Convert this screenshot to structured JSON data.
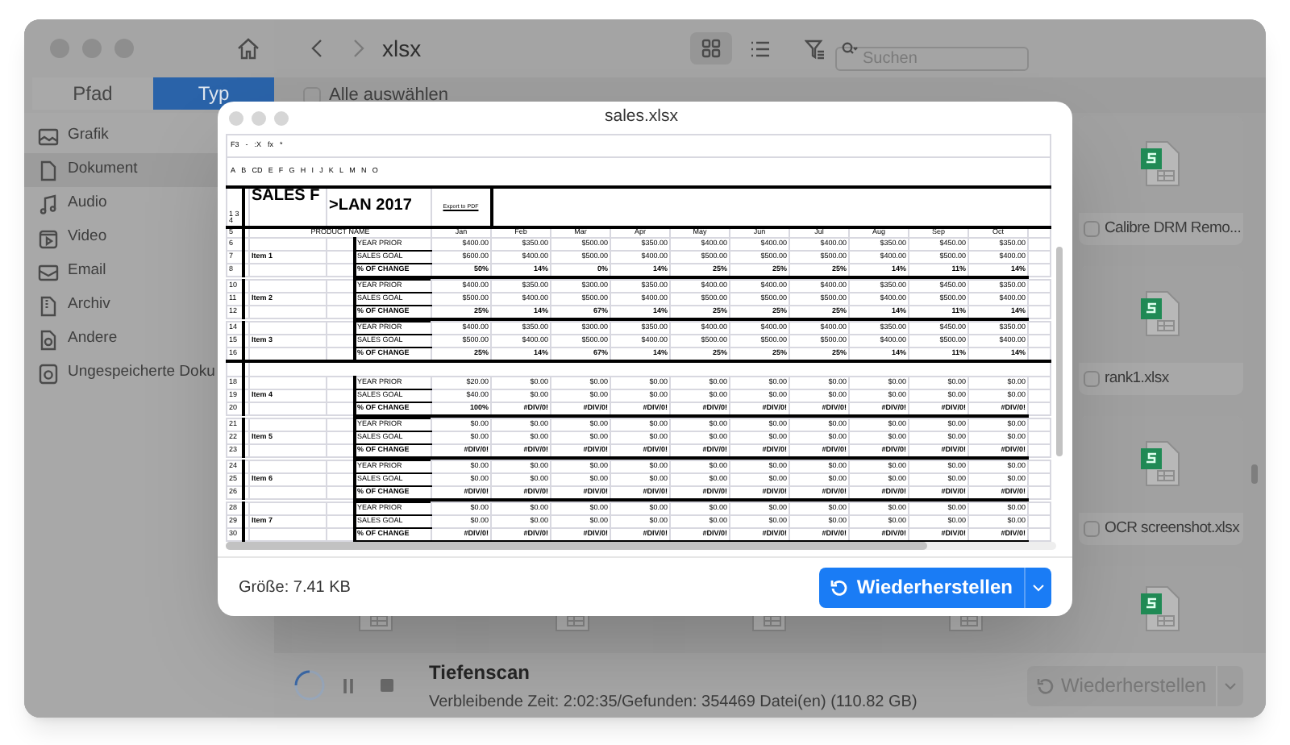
{
  "app": {
    "title": "xlsx",
    "views": [
      {
        "selected": true
      },
      {
        "selected": false
      }
    ],
    "search": {
      "placeholder": "Suchen"
    },
    "tabs": [
      {
        "label": "Pfad",
        "selected": false
      },
      {
        "label": "Typ",
        "selected": true
      }
    ],
    "select_all": {
      "label": "Alle auswählen",
      "checked": false
    },
    "sidebar": {
      "items": [
        {
          "label": "Grafik",
          "selected": false
        },
        {
          "label": "Dokument",
          "selected": true
        },
        {
          "label": "Audio",
          "selected": false
        },
        {
          "label": "Video",
          "selected": false
        },
        {
          "label": "Email",
          "selected": false
        },
        {
          "label": "Archiv",
          "selected": false
        },
        {
          "label": "Andere",
          "selected": false
        },
        {
          "label": "Ungespeicherte Doku",
          "selected": false
        }
      ]
    },
    "files": [
      {
        "name": "Calibre DRM Remo...",
        "checked": false
      },
      {
        "name": "rank1.xlsx",
        "checked": false
      },
      {
        "name": "OCR screenshot.xlsx",
        "checked": false
      }
    ],
    "scan": {
      "title": "Tiefenscan",
      "status": "Verbleibende Zeit: 2:02:35/Gefunden: 354469 Datei(en) (110.82 GB)",
      "button": "Wiederherstellen",
      "disabled": true
    }
  },
  "preview": {
    "title": "sales.xlsx",
    "size": "Größe: 7.41 KB",
    "button": "Wiederherstellen",
    "sheet": {
      "formula_bar": [
        "F3",
        "-",
        ":X",
        "fx",
        "*"
      ],
      "column_letters": [
        "A",
        "B",
        "CD",
        "E",
        "F",
        "G",
        "H",
        "I",
        "J",
        "K",
        "L",
        "M",
        "N",
        "O"
      ],
      "header_row_numbers": "1 3 4",
      "title_left": "SALES F",
      "title_right": ">LAN 2017",
      "export": "Export to PDF",
      "months_row_number": "5",
      "product_header": "PRODUCT NAME",
      "months": [
        "Jan",
        "Feb",
        "Mar",
        "Apr",
        "May",
        "Jun",
        "Jul",
        "Aug",
        "Sep",
        "Oct"
      ],
      "groups": [
        {
          "item": "Item 1",
          "rows": [
            {
              "number": "6",
              "label": "YEAR PRIOR",
              "values": [
                "$400.00",
                "$350.00",
                "$500.00",
                "$350.00",
                "$400.00",
                "$400.00",
                "$400.00",
                "$350.00",
                "$450.00",
                "$350.00"
              ]
            },
            {
              "number": "7",
              "label": "SALES GOAL",
              "values": [
                "$600.00",
                "$400.00",
                "$500.00",
                "$400.00",
                "$500.00",
                "$500.00",
                "$500.00",
                "$400.00",
                "$500.00",
                "$400.00"
              ]
            },
            {
              "number": "8",
              "label": "% OF CHANGE",
              "values": [
                "50%",
                "14%",
                "0%",
                "14%",
                "25%",
                "25%",
                "25%",
                "14%",
                "11%",
                "14%"
              ]
            }
          ]
        },
        {
          "item": "Item 2",
          "rows": [
            {
              "number": "10",
              "label": "YEAR PRIOR",
              "values": [
                "$400.00",
                "$350.00",
                "$300.00",
                "$350.00",
                "$400.00",
                "$400.00",
                "$400.00",
                "$350.00",
                "$450.00",
                "$350.00"
              ]
            },
            {
              "number": "11",
              "label": "SALES GOAL",
              "values": [
                "$500.00",
                "$400.00",
                "$500.00",
                "$400.00",
                "$500.00",
                "$500.00",
                "$500.00",
                "$400.00",
                "$500.00",
                "$400.00"
              ]
            },
            {
              "number": "12",
              "label": "% OF CHANGE",
              "values": [
                "25%",
                "14%",
                "67%",
                "14%",
                "25%",
                "25%",
                "25%",
                "14%",
                "11%",
                "14%"
              ]
            }
          ]
        },
        {
          "item": "Item 3",
          "rows": [
            {
              "number": "14",
              "label": "YEAR PRIOR",
              "values": [
                "$400.00",
                "$350.00",
                "$300.00",
                "$350.00",
                "$400.00",
                "$400.00",
                "$400.00",
                "$350.00",
                "$450.00",
                "$350.00"
              ]
            },
            {
              "number": "15",
              "label": "SALES GOAL",
              "values": [
                "$500.00",
                "$400.00",
                "$500.00",
                "$400.00",
                "$500.00",
                "$500.00",
                "$500.00",
                "$400.00",
                "$500.00",
                "$400.00"
              ]
            },
            {
              "number": "16",
              "label": "% OF CHANGE",
              "values": [
                "25%",
                "14%",
                "67%",
                "14%",
                "25%",
                "25%",
                "25%",
                "14%",
                "11%",
                "14%"
              ]
            }
          ]
        },
        {
          "item": "Item 4",
          "rows": [
            {
              "number": "18",
              "label": "YEAR PRIOR",
              "values": [
                "$20.00",
                "$0.00",
                "$0.00",
                "$0.00",
                "$0.00",
                "$0.00",
                "$0.00",
                "$0.00",
                "$0.00",
                "$0.00"
              ]
            },
            {
              "number": "19",
              "label": "SALES GOAL",
              "values": [
                "$40.00",
                "$0.00",
                "$0.00",
                "$0.00",
                "$0.00",
                "$0.00",
                "$0.00",
                "$0.00",
                "$0.00",
                "$0.00"
              ]
            },
            {
              "number": "20",
              "label": "% OF CHANGE",
              "values": [
                "100%",
                "#DIV/0!",
                "#DIV/0!",
                "#DIV/0!",
                "#DIV/0!",
                "#DIV/0!",
                "#DIV/0!",
                "#DIV/0!",
                "#DIV/0!",
                "#DIV/0!"
              ]
            }
          ]
        },
        {
          "item": "Item 5",
          "rows": [
            {
              "number": "21",
              "label": "YEAR PRIOR",
              "values": [
                "$0.00",
                "$0.00",
                "$0.00",
                "$0.00",
                "$0.00",
                "$0.00",
                "$0.00",
                "$0.00",
                "$0.00",
                "$0.00"
              ]
            },
            {
              "number": "22",
              "label": "SALES GOAL",
              "values": [
                "$0.00",
                "$0.00",
                "$0.00",
                "$0.00",
                "$0.00",
                "$0.00",
                "$0.00",
                "$0.00",
                "$0.00",
                "$0.00"
              ]
            },
            {
              "number": "23",
              "label": "% OF CHANGE",
              "values": [
                "#DIV/0!",
                "#DIV/0!",
                "#DIV/0!",
                "#DIV/0!",
                "#DIV/0!",
                "#DIV/0!",
                "#DIV/0!",
                "#DIV/0!",
                "#DIV/0!",
                "#DIV/0!"
              ]
            }
          ]
        },
        {
          "item": "Item 6",
          "rows": [
            {
              "number": "24",
              "label": "YEAR PRIOR",
              "values": [
                "$0.00",
                "$0.00",
                "$0.00",
                "$0.00",
                "$0.00",
                "$0.00",
                "$0.00",
                "$0.00",
                "$0.00",
                "$0.00"
              ]
            },
            {
              "number": "25",
              "label": "SALES GOAL",
              "values": [
                "$0.00",
                "$0.00",
                "$0.00",
                "$0.00",
                "$0.00",
                "$0.00",
                "$0.00",
                "$0.00",
                "$0.00",
                "$0.00"
              ]
            },
            {
              "number": "26",
              "label": "% OF CHANGE",
              "values": [
                "#DIV/0!",
                "#DIV/0!",
                "#DIV/0!",
                "#DIV/0!",
                "#DIV/0!",
                "#DIV/0!",
                "#DIV/0!",
                "#DIV/0!",
                "#DIV/0!",
                "#DIV/0!"
              ]
            }
          ]
        },
        {
          "item": "Item 7",
          "rows": [
            {
              "number": "28",
              "label": "YEAR PRIOR",
              "values": [
                "$0.00",
                "$0.00",
                "$0.00",
                "$0.00",
                "$0.00",
                "$0.00",
                "$0.00",
                "$0.00",
                "$0.00",
                "$0.00"
              ]
            },
            {
              "number": "29",
              "label": "SALES GOAL",
              "values": [
                "$0.00",
                "$0.00",
                "$0.00",
                "$0.00",
                "$0.00",
                "$0.00",
                "$0.00",
                "$0.00",
                "$0.00",
                "$0.00"
              ]
            },
            {
              "number": "30",
              "label": "% OF CHANGE",
              "values": [
                "#DIV/0!",
                "#DIV/0!",
                "#DIV/0!",
                "#DIV/0!",
                "#DIV/0!",
                "#DIV/0!",
                "#DIV/0!",
                "#DIV/0!",
                "#DIV/0!",
                "#DIV/0!"
              ]
            }
          ]
        }
      ]
    }
  }
}
